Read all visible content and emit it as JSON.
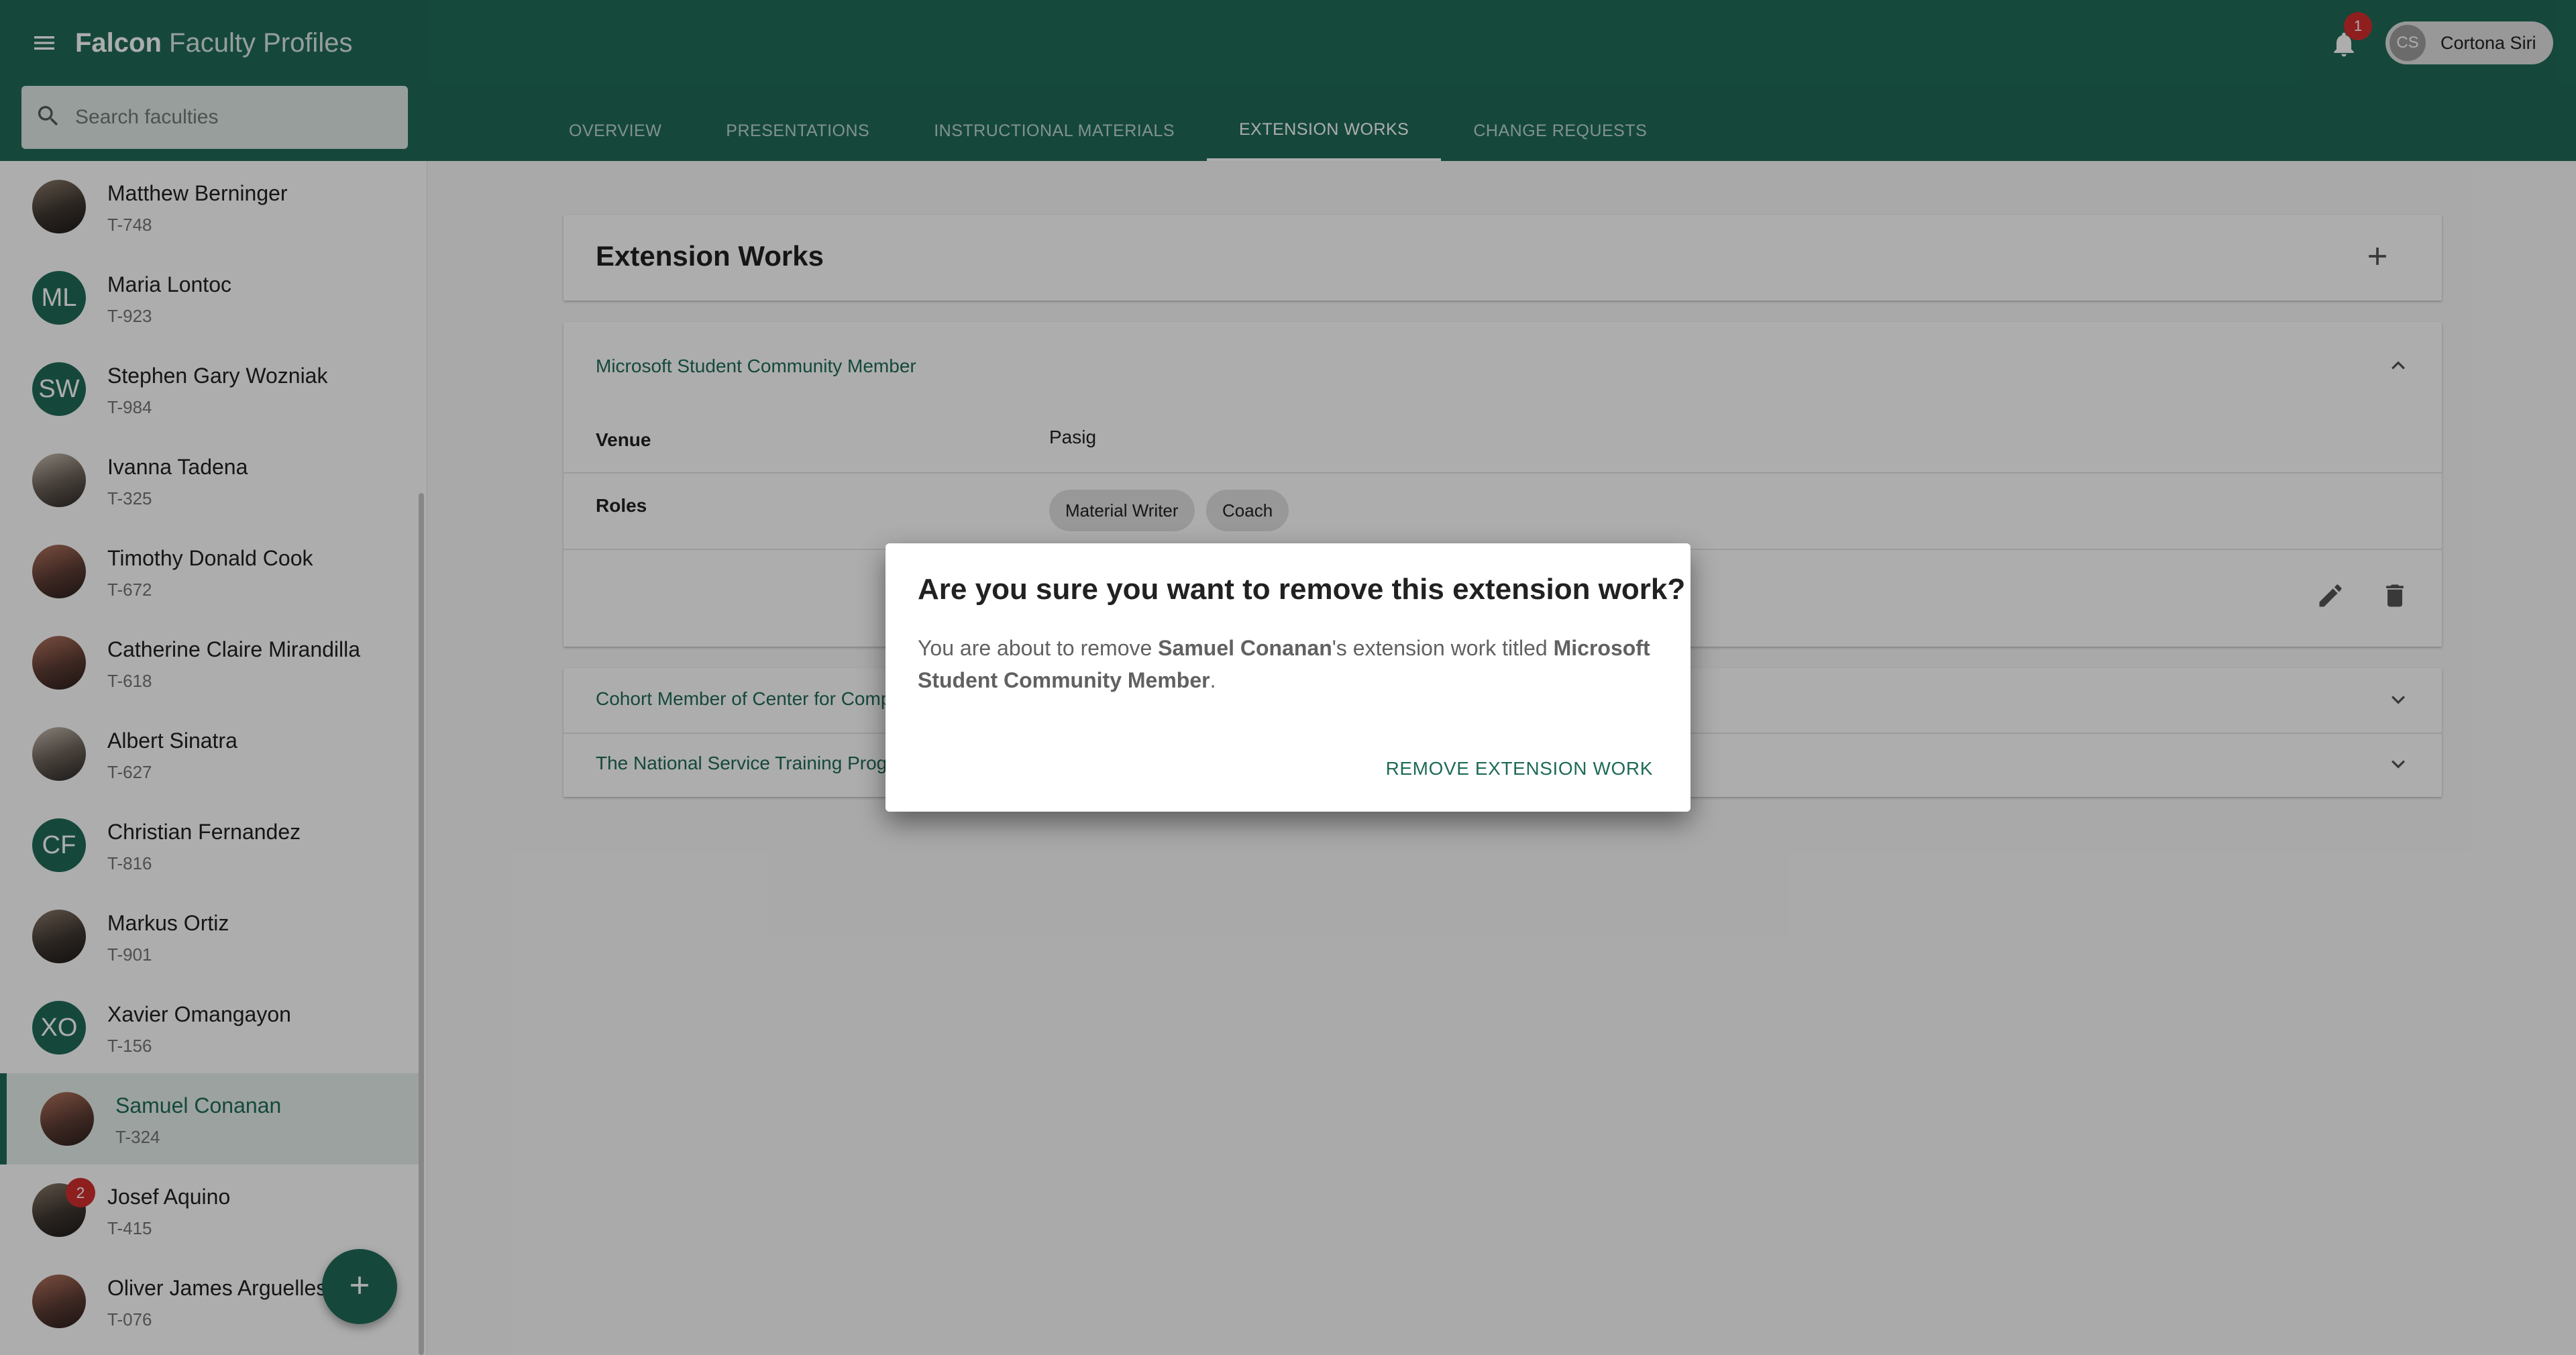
{
  "app": {
    "brand": "Falcon",
    "title": "Faculty Profiles"
  },
  "search": {
    "placeholder": "Search faculties"
  },
  "tabs": [
    {
      "label": "OVERVIEW"
    },
    {
      "label": "PRESENTATIONS"
    },
    {
      "label": "INSTRUCTIONAL MATERIALS"
    },
    {
      "label": "EXTENSION WORKS",
      "active": true
    },
    {
      "label": "CHANGE REQUESTS"
    }
  ],
  "notifications": {
    "count": "1"
  },
  "user": {
    "initials": "CS",
    "name": "Cortona Siri"
  },
  "faculties": [
    {
      "name": "Matthew Berninger",
      "id": "T-748",
      "avatar": "photo"
    },
    {
      "name": "Maria Lontoc",
      "id": "T-923",
      "initials": "ML"
    },
    {
      "name": "Stephen Gary Wozniak",
      "id": "T-984",
      "initials": "SW"
    },
    {
      "name": "Ivanna Tadena",
      "id": "T-325",
      "avatar": "photo"
    },
    {
      "name": "Timothy Donald Cook",
      "id": "T-672",
      "avatar": "photo"
    },
    {
      "name": "Catherine Claire Mirandilla",
      "id": "T-618",
      "avatar": "photo"
    },
    {
      "name": "Albert Sinatra",
      "id": "T-627",
      "avatar": "photo"
    },
    {
      "name": "Christian Fernandez",
      "id": "T-816",
      "initials": "CF"
    },
    {
      "name": "Markus Ortiz",
      "id": "T-901",
      "avatar": "photo"
    },
    {
      "name": "Xavier Omangayon",
      "id": "T-156",
      "initials": "XO"
    },
    {
      "name": "Samuel Conanan",
      "id": "T-324",
      "avatar": "photo",
      "selected": true
    },
    {
      "name": "Josef Aquino",
      "id": "T-415",
      "avatar": "photo",
      "badge": "2"
    },
    {
      "name": "Oliver James Arguelles",
      "id": "T-076",
      "avatar": "photo"
    }
  ],
  "main": {
    "section_title": "Extension Works",
    "expanded_work": {
      "title": "Microsoft Student Community Member",
      "venue_label": "Venue",
      "venue_value": "Pasig",
      "roles_label": "Roles",
      "roles": [
        "Material Writer",
        "Coach"
      ]
    },
    "collapsed_works": [
      {
        "title": "Cohort Member of Center for Comp"
      },
      {
        "title": "The National Service Training Prog"
      }
    ]
  },
  "dialog": {
    "title": "Are you sure you want to remove this extension work?",
    "body_prefix": "You are about to remove ",
    "faculty_name": "Samuel Conanan",
    "body_middle": "'s extension work titled ",
    "work_title": "Microsoft Student Community Member",
    "body_suffix": ".",
    "confirm_label": "REMOVE EXTENSION WORK"
  },
  "colors": {
    "primary": "#1f6b58",
    "badge": "#d32f2f",
    "chip": "#e0e0e0"
  },
  "icons": [
    "menu-icon",
    "search-icon",
    "bell-icon",
    "plus-icon",
    "chevron-up-icon",
    "chevron-down-icon",
    "edit-icon",
    "delete-icon"
  ]
}
